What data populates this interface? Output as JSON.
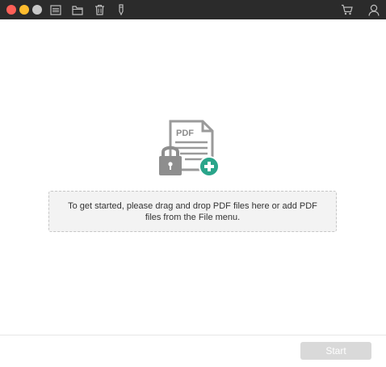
{
  "window": {
    "controls": {
      "close_color": "#fe5f57",
      "minimize_color": "#febc2e",
      "zoom_color": "#c8c8c8"
    }
  },
  "toolbar": {
    "left_icons": [
      "list-icon",
      "folder-icon",
      "trash-icon",
      "pen-icon"
    ],
    "right_icons": [
      "cart-icon",
      "user-icon"
    ]
  },
  "dropzone": {
    "icon": "pdf-lock-add-icon",
    "icon_text": "PDF",
    "accent_color": "#2aa58a",
    "message": "To get started, please drag and drop PDF files here or add PDF files from the File menu."
  },
  "footer": {
    "start_label": "Start",
    "start_enabled": false
  }
}
